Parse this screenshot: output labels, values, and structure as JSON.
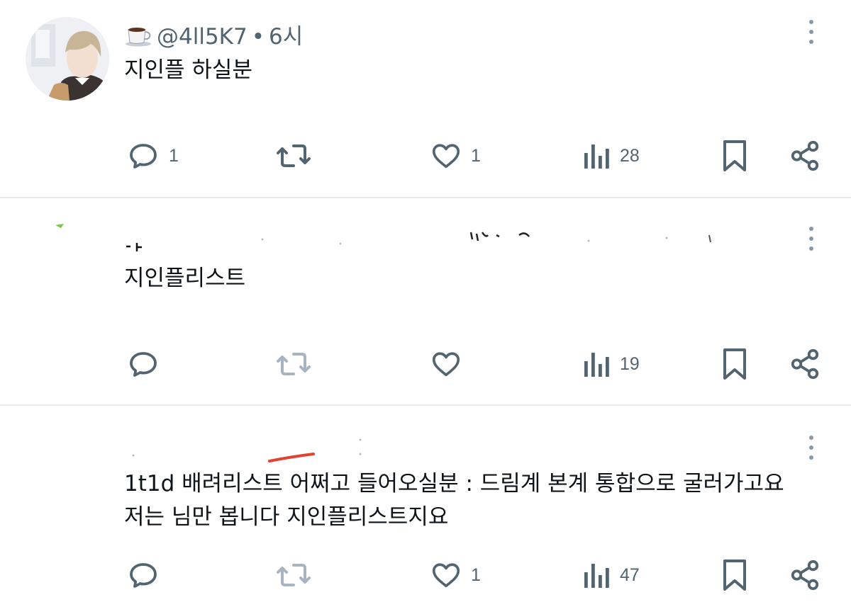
{
  "posts": [
    {
      "handle": "@4ll5K7",
      "separator": "•",
      "time": "6시",
      "text": "지인플 하실분",
      "replies": "1",
      "retweets": "",
      "likes": "1",
      "views": "28"
    },
    {
      "text": "지인플리스트",
      "replies": "",
      "retweets": "",
      "likes": "",
      "views": "19"
    },
    {
      "text_line1": "1t1d 배려리스트 어쩌고 들어오실분 : 드림계 본계 통합으로 굴러가고요",
      "text_line2": "저는 님만 봅니다 지인플리스트지요",
      "replies": "",
      "retweets": "",
      "likes": "1",
      "views": "47"
    }
  ],
  "colors": {
    "text": "#0f1419",
    "secondary": "#536471",
    "icon": "#536471",
    "icon_disabled": "#a8b5c0",
    "divider": "#e7e9ea"
  }
}
